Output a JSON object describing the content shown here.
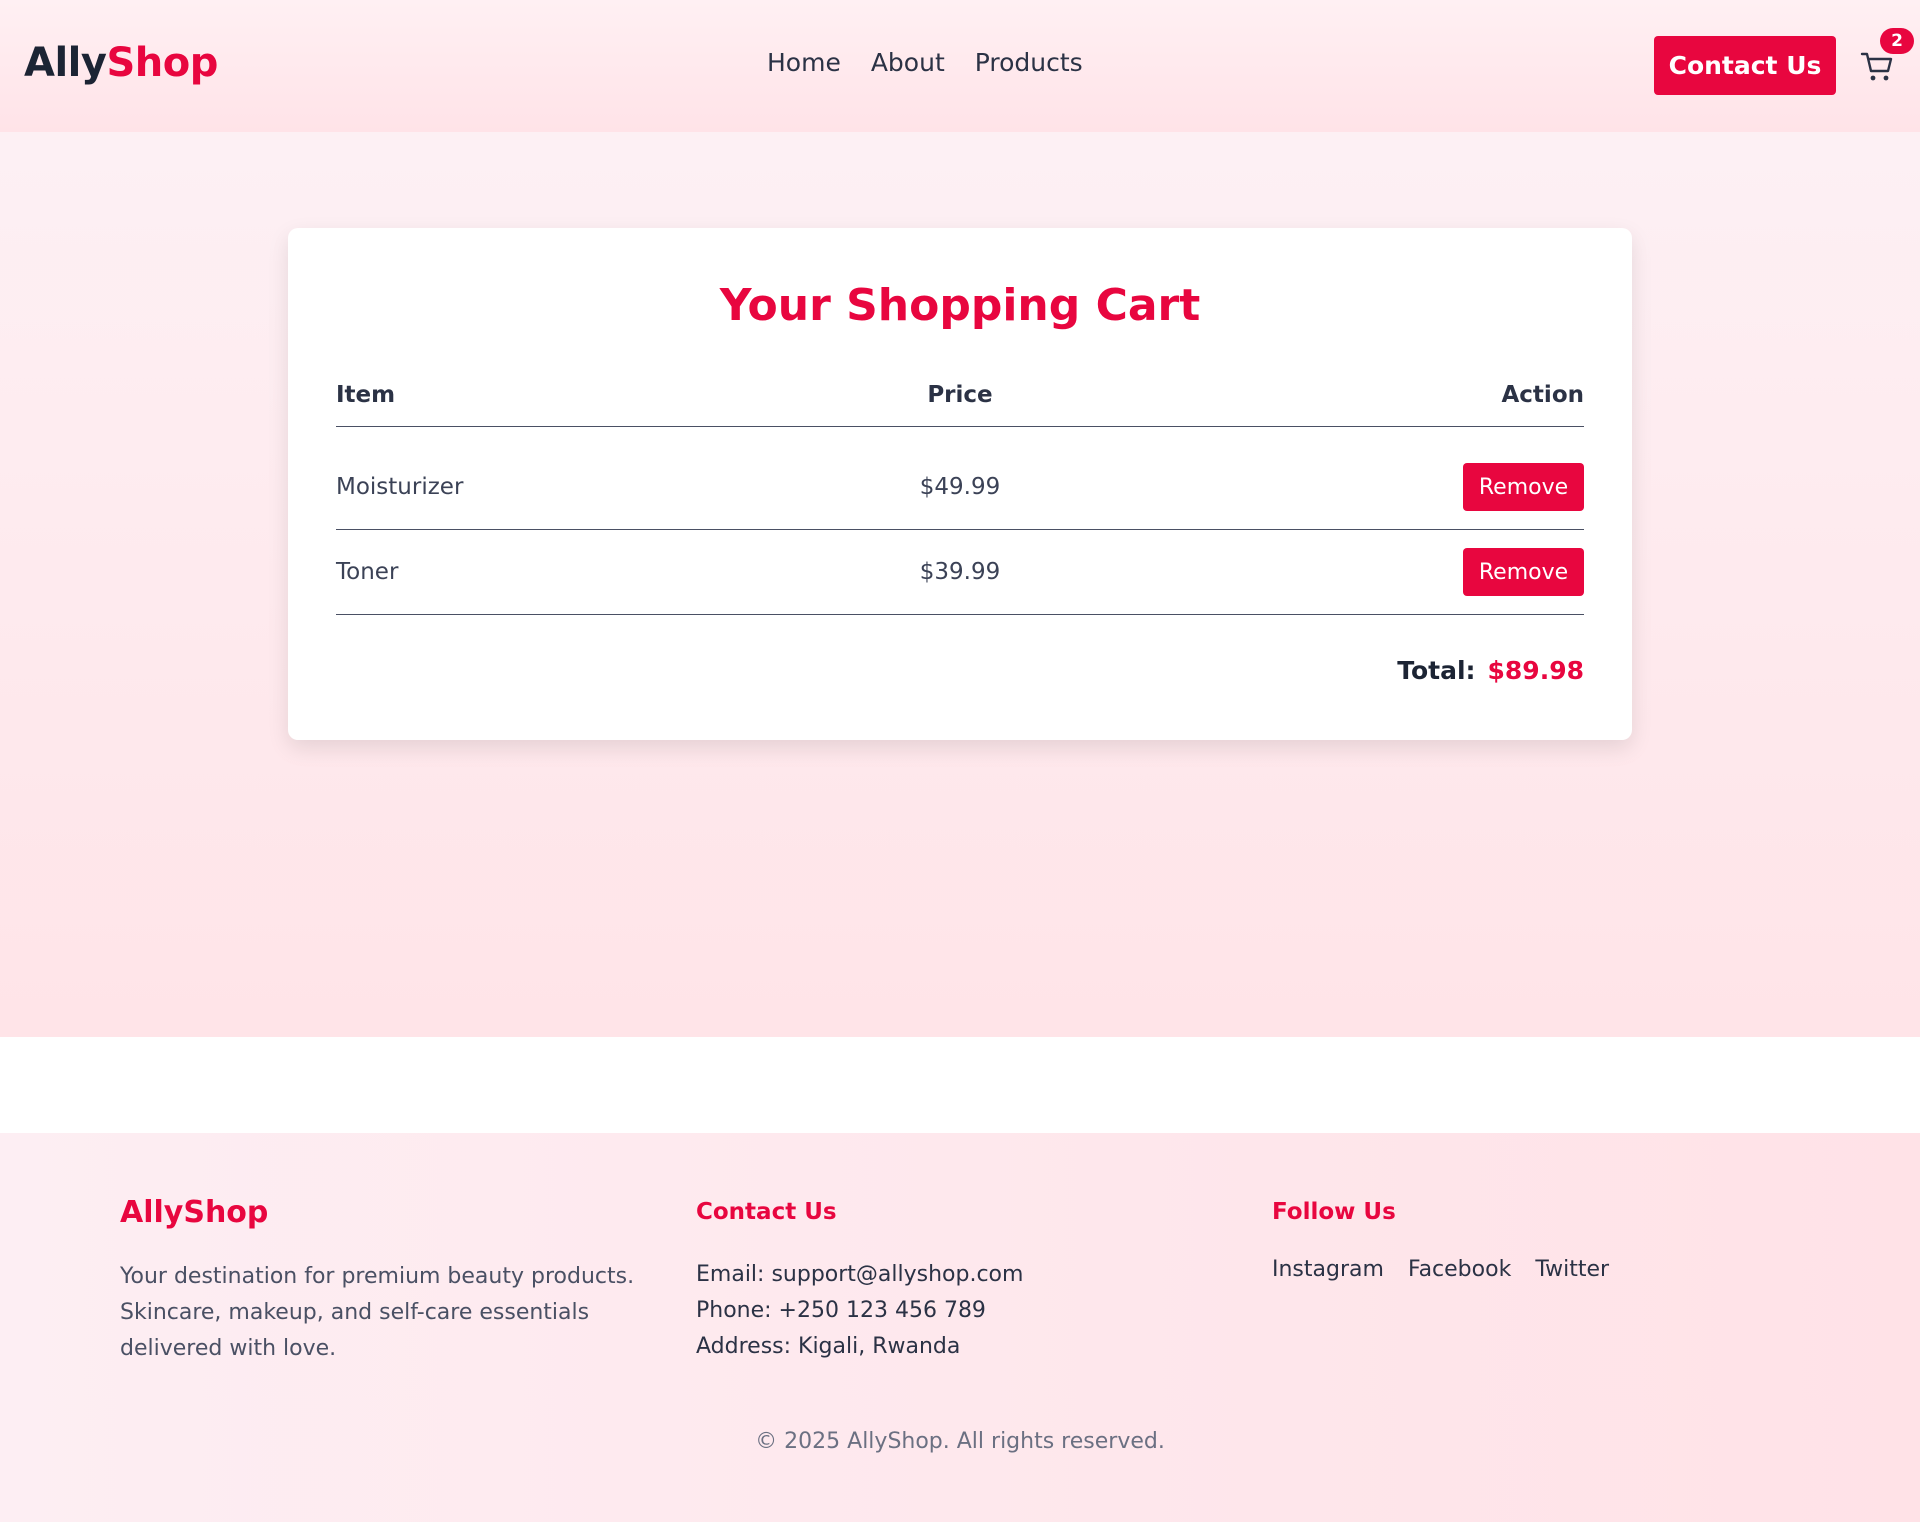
{
  "header": {
    "logo_part1": "Ally",
    "logo_part2": "Shop",
    "nav": [
      "Home",
      "About",
      "Products"
    ],
    "contact_button": "Contact Us",
    "cart_icon": "cart-icon",
    "cart_count": "2"
  },
  "cart": {
    "title": "Your Shopping Cart",
    "columns": [
      "Item",
      "Price",
      "Action"
    ],
    "items": [
      {
        "name": "Moisturizer",
        "price": "$49.99",
        "action": "Remove"
      },
      {
        "name": "Toner",
        "price": "$39.99",
        "action": "Remove"
      }
    ],
    "total_label": "Total:",
    "total_value": "$89.98"
  },
  "footer": {
    "brand": "AllyShop",
    "description": "Your destination for premium beauty products. Skincare, makeup, and self-care essentials delivered with love.",
    "contact_heading": "Contact Us",
    "email": "Email: support@allyshop.com",
    "phone": "Phone: +250 123 456 789",
    "address": "Address: Kigali, Rwanda",
    "follow_heading": "Follow Us",
    "social": [
      "Instagram",
      "Facebook",
      "Twitter"
    ],
    "copyright": "© 2025 AllyShop. All rights reserved."
  },
  "colors": {
    "accent": "#e8063f",
    "text_dark": "#1c2434"
  }
}
